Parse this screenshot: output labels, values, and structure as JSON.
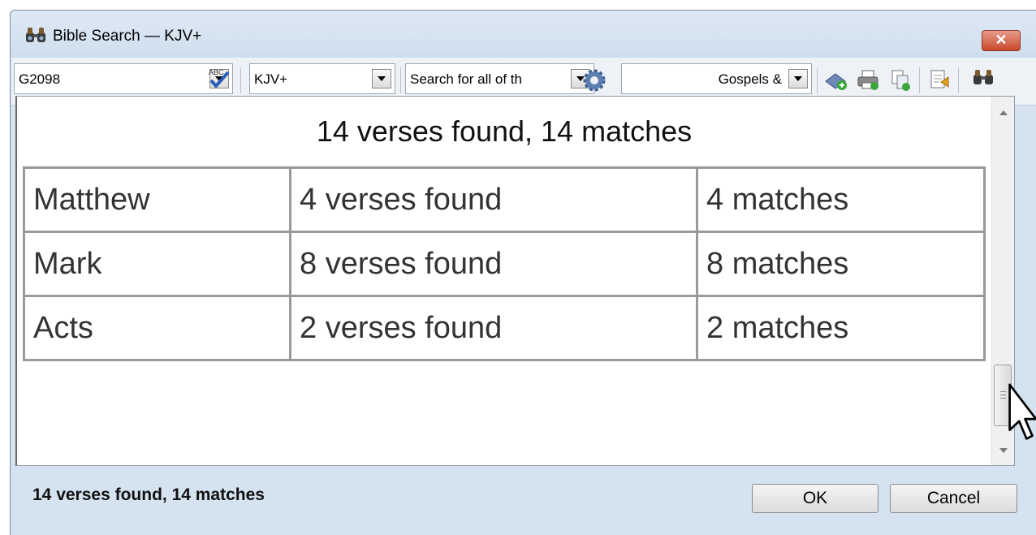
{
  "window": {
    "title": "Bible Search — KJV+",
    "close_label": "✕"
  },
  "toolbar": {
    "search_term": "G2098",
    "version": "KJV+",
    "search_mode": "Search for all of th",
    "range": "Gospels &"
  },
  "results": {
    "heading": "14 verses found, 14 matches",
    "rows": [
      {
        "book": "Matthew",
        "verses": "4 verses found",
        "matches": "4 matches"
      },
      {
        "book": "Mark",
        "verses": "8 verses found",
        "matches": "8 matches"
      },
      {
        "book": "Acts",
        "verses": "2 verses found",
        "matches": "2 matches"
      }
    ]
  },
  "footer": {
    "status": "14 verses found, 14 matches",
    "ok_label": "OK",
    "cancel_label": "Cancel"
  },
  "icons": {
    "title": "binoculars-icon",
    "spell": "spellcheck-icon",
    "options": "gear-icon",
    "toolbar": [
      "add-to-list-icon",
      "print-icon",
      "copy-icon",
      "export-icon",
      "search-icon"
    ]
  },
  "colors": {
    "window_frame": "#d5e3f1",
    "close_button": "#c9462c",
    "table_border": "#9a9a9a"
  }
}
